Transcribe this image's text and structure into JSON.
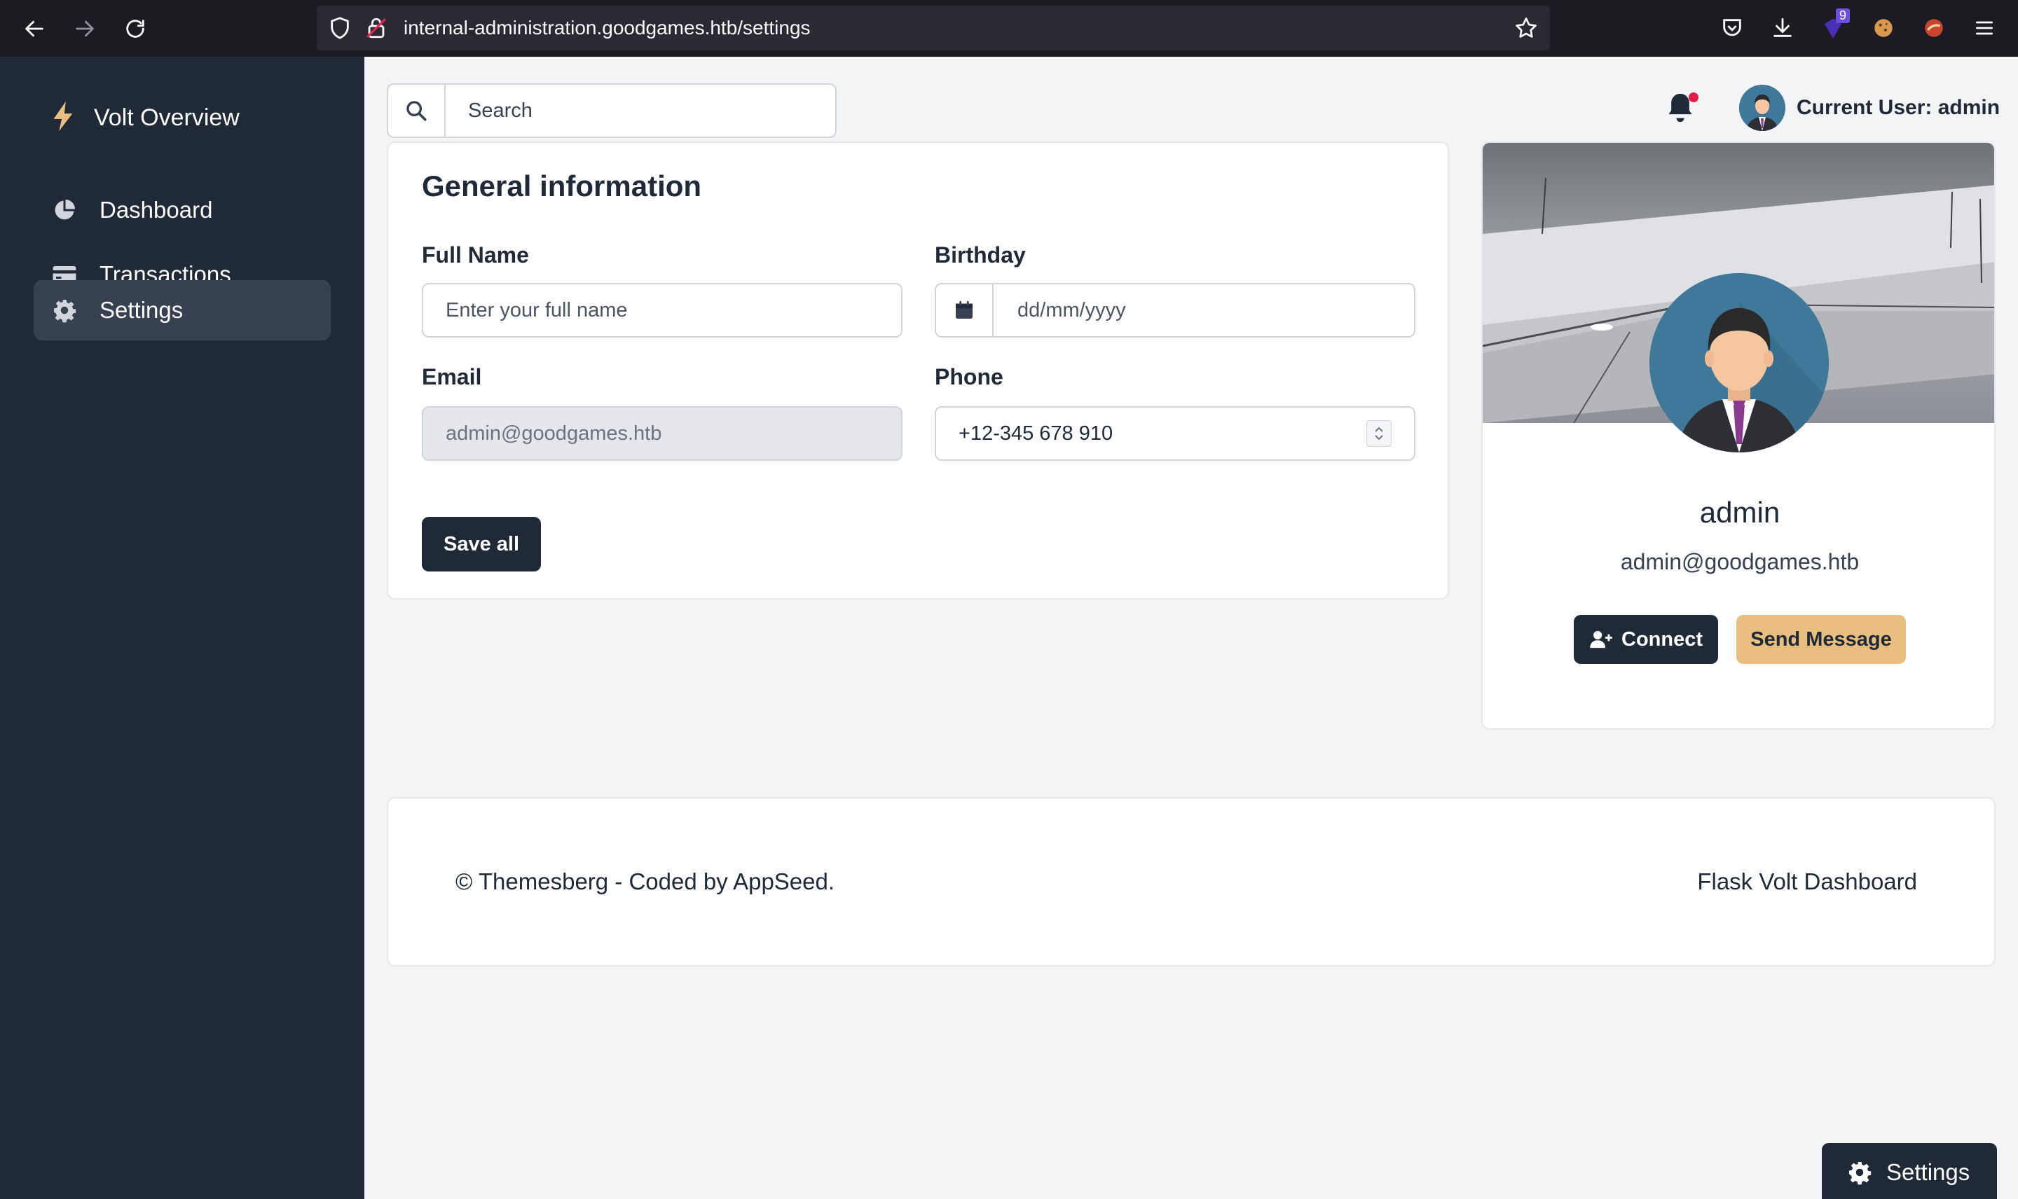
{
  "browser": {
    "url": "internal-administration.goodgames.htb/settings",
    "extension_badge": "9"
  },
  "sidebar": {
    "brand": "Volt Overview",
    "items": [
      {
        "label": "Dashboard",
        "icon": "pie-chart-icon"
      },
      {
        "label": "Transactions",
        "icon": "credit-card-icon"
      },
      {
        "label": "Settings",
        "icon": "gear-icon",
        "active": true
      }
    ]
  },
  "topbar": {
    "search_placeholder": "Search",
    "current_user_label": "Current User: admin"
  },
  "general": {
    "title": "General information",
    "full_name_label": "Full Name",
    "full_name_placeholder": "Enter your full name",
    "birthday_label": "Birthday",
    "birthday_placeholder": "dd/mm/yyyy",
    "email_label": "Email",
    "email_value": "admin@goodgames.htb",
    "phone_label": "Phone",
    "phone_value": "+12-345 678 910",
    "save_label": "Save all"
  },
  "profile": {
    "name": "admin",
    "email": "admin@goodgames.htb",
    "connect_label": "Connect",
    "message_label": "Send Message"
  },
  "footer": {
    "left_text": "© Themesberg - Coded by AppSeed.",
    "right_text": "Flask Volt Dashboard"
  },
  "floating": {
    "settings_label": "Settings"
  },
  "colors": {
    "sidebar_bg": "#1f2937",
    "accent_dark": "#1f2937",
    "warning": "#e8bf7f",
    "notification_dot": "#e11d48"
  }
}
